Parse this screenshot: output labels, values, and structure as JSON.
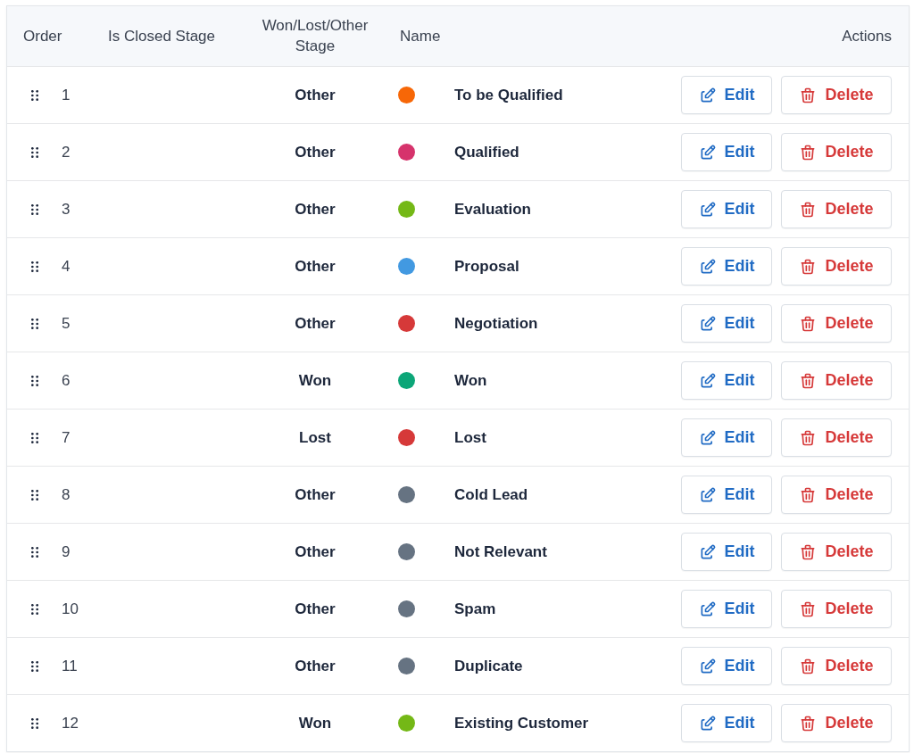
{
  "table": {
    "columns": [
      "Order",
      "Is Closed Stage",
      "Won/Lost/Other Stage",
      "Name",
      "Actions"
    ],
    "rows": [
      {
        "order": "1",
        "stage": "Other",
        "color": "#f76707",
        "name": "To be Qualified",
        "edit": "Edit",
        "delete": "Delete"
      },
      {
        "order": "2",
        "stage": "Other",
        "color": "#d6336c",
        "name": "Qualified",
        "edit": "Edit",
        "delete": "Delete"
      },
      {
        "order": "3",
        "stage": "Other",
        "color": "#74b816",
        "name": "Evaluation",
        "edit": "Edit",
        "delete": "Delete"
      },
      {
        "order": "4",
        "stage": "Other",
        "color": "#4299e1",
        "name": "Proposal",
        "edit": "Edit",
        "delete": "Delete"
      },
      {
        "order": "5",
        "stage": "Other",
        "color": "#d63939",
        "name": "Negotiation",
        "edit": "Edit",
        "delete": "Delete"
      },
      {
        "order": "6",
        "stage": "Won",
        "color": "#0ca678",
        "name": "Won",
        "edit": "Edit",
        "delete": "Delete"
      },
      {
        "order": "7",
        "stage": "Lost",
        "color": "#d63939",
        "name": "Lost",
        "edit": "Edit",
        "delete": "Delete"
      },
      {
        "order": "8",
        "stage": "Other",
        "color": "#667382",
        "name": "Cold Lead",
        "edit": "Edit",
        "delete": "Delete"
      },
      {
        "order": "9",
        "stage": "Other",
        "color": "#667382",
        "name": "Not Relevant",
        "edit": "Edit",
        "delete": "Delete"
      },
      {
        "order": "10",
        "stage": "Other",
        "color": "#667382",
        "name": "Spam",
        "edit": "Edit",
        "delete": "Delete"
      },
      {
        "order": "11",
        "stage": "Other",
        "color": "#667382",
        "name": "Duplicate",
        "edit": "Edit",
        "delete": "Delete"
      },
      {
        "order": "12",
        "stage": "Won",
        "color": "#74b816",
        "name": "Existing Customer",
        "edit": "Edit",
        "delete": "Delete"
      }
    ]
  }
}
